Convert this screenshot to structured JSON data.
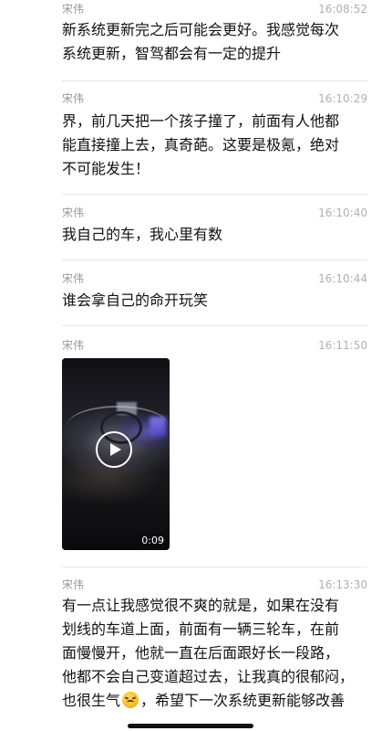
{
  "messages": [
    {
      "sender": "宋伟",
      "time": "16:08:52",
      "lines": [
        "新系统更新完之后可能会更好。我感觉每次",
        "系统更新，智驾都会有一定的提升"
      ]
    },
    {
      "sender": "宋伟",
      "time": "16:10:29",
      "lines": [
        "界，前几天把一个孩子撞了，前面有人他都",
        "能直接撞上去，真奇葩。这要是极氪，绝对",
        "不可能发生！"
      ]
    },
    {
      "sender": "宋伟",
      "time": "16:10:40",
      "lines": [
        "我自己的车，我心里有数"
      ]
    },
    {
      "sender": "宋伟",
      "time": "16:10:44",
      "lines": [
        "谁会拿自己的命开玩笑"
      ]
    },
    {
      "sender": "宋伟",
      "time": "16:11:50",
      "video": {
        "duration": "0:09",
        "icon": "play-icon"
      }
    },
    {
      "sender": "宋伟",
      "time": "16:13:30",
      "lines": [
        "有一点让我感觉很不爽的就是，如果在没有",
        "划线的车道上面，前面有一辆三轮车，在前",
        "面慢慢开，他就一直在后面跟好长一段路，",
        "他都不会自己变道超过去，让我真的很郁闷，"
      ],
      "last_line_before_emoji": "也很生气",
      "emoji": "angry-face-icon",
      "last_line_after_emoji": "，希望下一次系统更新能够改善"
    }
  ],
  "colors": {
    "background": "#ffffff",
    "text": "#111111",
    "meta": "#9a9a9a",
    "divider": "#e6e6e6"
  }
}
